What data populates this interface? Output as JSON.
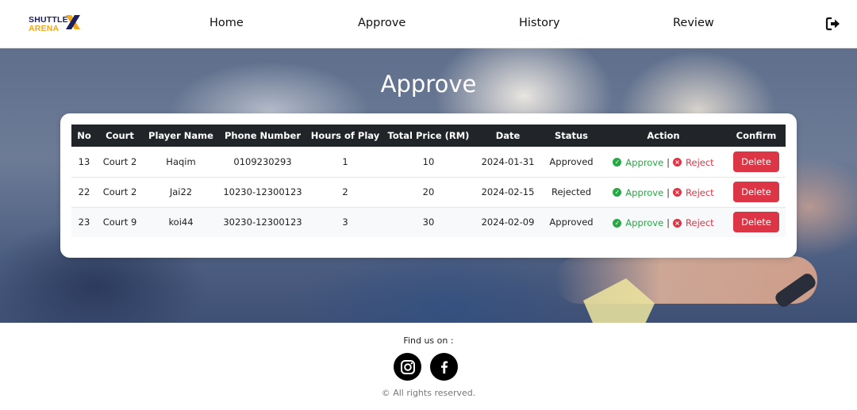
{
  "brand": {
    "line1": "SHUTTLE",
    "line2": "ARENA",
    "mark": "X"
  },
  "nav": {
    "home": "Home",
    "approve": "Approve",
    "history": "History",
    "review": "Review"
  },
  "hero": {
    "title": "Approve"
  },
  "table": {
    "headers": [
      "No",
      "Court",
      "Player Name",
      "Phone Number",
      "Hours of Play",
      "Total Price (RM)",
      "Date",
      "Status",
      "Action",
      "Confirm"
    ],
    "rows": [
      {
        "no": "13",
        "court": "Court 2",
        "player": "Haqim",
        "phone": "0109230293",
        "hours": "1",
        "price": "10",
        "date": "2024-01-31",
        "status": "Approved"
      },
      {
        "no": "22",
        "court": "Court 2",
        "player": "Jai22",
        "phone": "10230-12300123",
        "hours": "2",
        "price": "20",
        "date": "2024-02-15",
        "status": "Rejected"
      },
      {
        "no": "23",
        "court": "Court 9",
        "player": "koi44",
        "phone": "30230-12300123",
        "hours": "3",
        "price": "30",
        "date": "2024-02-09",
        "status": "Approved"
      }
    ],
    "actions": {
      "approve": "Approve",
      "separator": "|",
      "reject": "Reject",
      "delete": "Delete"
    }
  },
  "footer": {
    "find_us": "Find us on :",
    "rights": "© All rights reserved."
  },
  "icons": {
    "logout": "logout-icon",
    "instagram": "instagram-icon",
    "facebook": "facebook-icon",
    "approve": "check-circle-icon",
    "reject": "x-circle-icon"
  },
  "colors": {
    "approve": "#28a745",
    "reject": "#dc3545",
    "header_bg": "#212529",
    "brand_navy": "#1b1f5e",
    "brand_gold": "#f0a81c"
  }
}
